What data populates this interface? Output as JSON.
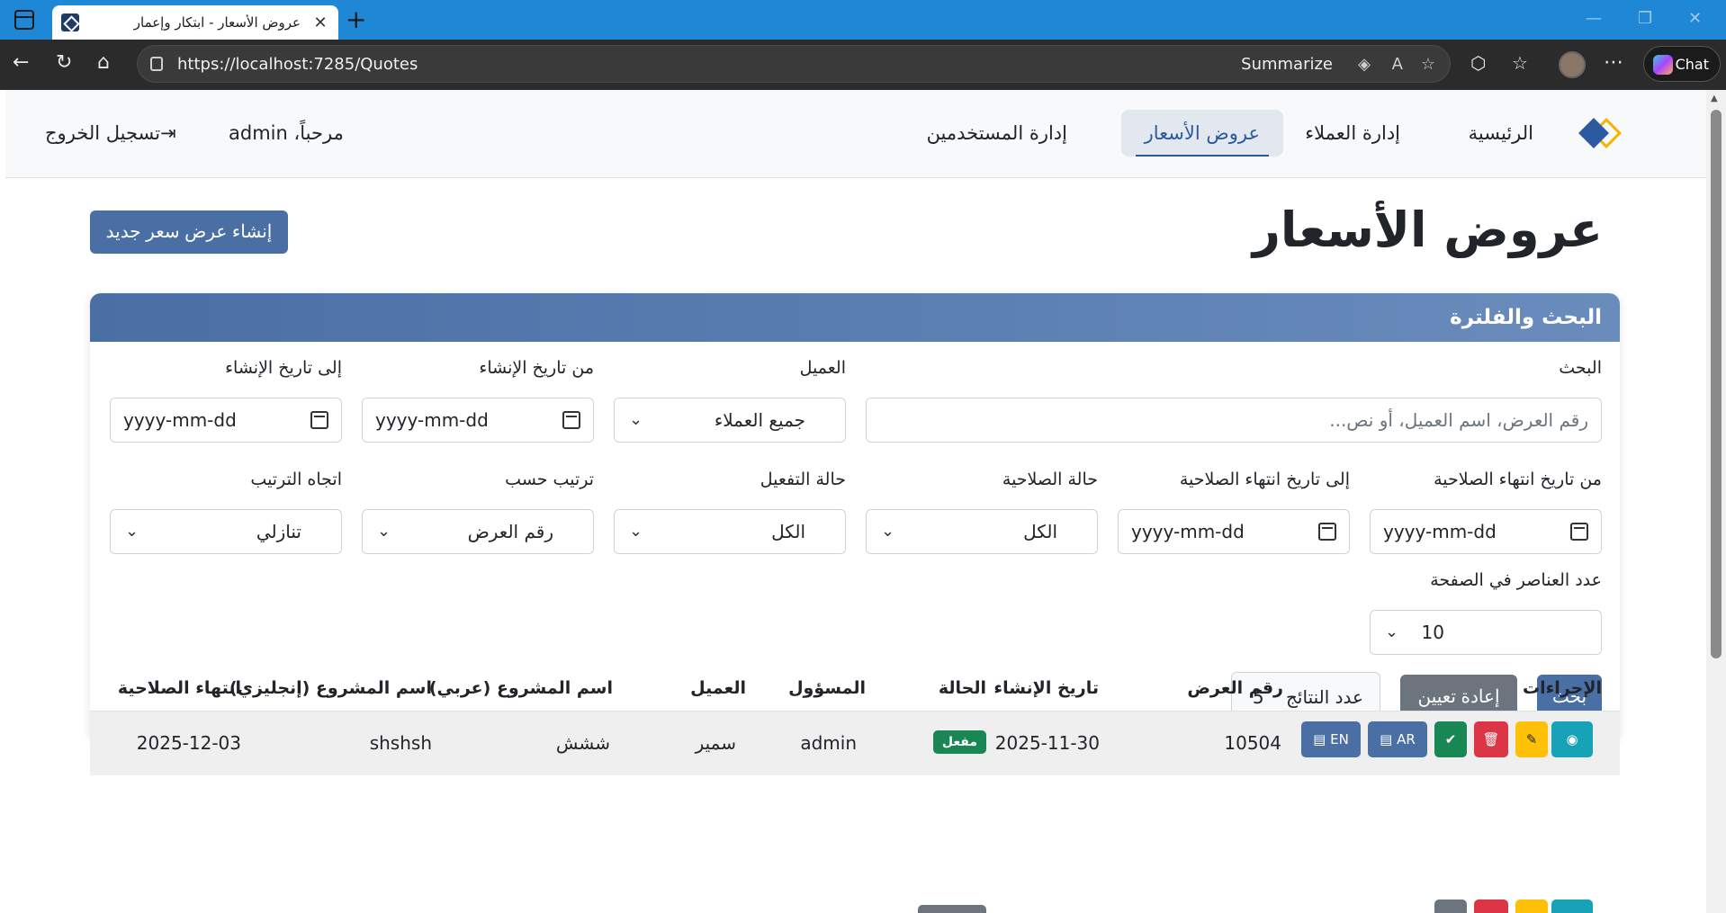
{
  "browser": {
    "tab_title": "عروض الأسعار - ابتكار وإعمار",
    "tab_close": "✕",
    "new_tab": "+",
    "url": "https://localhost:7285/Quotes",
    "summarize": "Summarize",
    "chat": "Chat"
  },
  "navbar": {
    "items": [
      {
        "label": "الرئيسية"
      },
      {
        "label": "إدارة العملاء"
      },
      {
        "label": "عروض الأسعار"
      },
      {
        "label": "إدارة المستخدمين"
      }
    ],
    "welcome": "مرحباً، admin",
    "logout": "تسجيل الخروج"
  },
  "page": {
    "title": "عروض الأسعار",
    "create_button": "إنشاء عرض سعر جديد"
  },
  "filters": {
    "header": "البحث والفلترة",
    "search_label": "البحث",
    "search_placeholder": "رقم العرض، اسم العميل، أو نص...",
    "client_label": "العميل",
    "client_value": "جميع العملاء",
    "from_created_label": "من تاريخ الإنشاء",
    "to_created_label": "إلى تاريخ الإنشاء",
    "date_placeholder": "yyyy-mm-dd",
    "from_expiry_label": "من تاريخ انتهاء الصلاحية",
    "to_expiry_label": "إلى تاريخ انتهاء الصلاحية",
    "validity_label": "حالة الصلاحية",
    "validity_value": "الكل",
    "activation_label": "حالة التفعيل",
    "activation_value": "الكل",
    "sort_by_label": "ترتيب حسب",
    "sort_by_value": "رقم العرض",
    "sort_dir_label": "اتجاه الترتيب",
    "sort_dir_value": "تنازلي",
    "page_size_label": "عدد العناصر في الصفحة",
    "page_size_value": "10",
    "search_button": "بحث",
    "reset_button": "إعادة تعيين",
    "results_label": "عدد النتائج",
    "results_count": "5"
  },
  "table": {
    "headers": [
      "الإجراءات",
      "رقم العرض",
      "تاريخ الإنشاء",
      "الحالة",
      "المسؤول",
      "العميل",
      "اسم المشروع (عربي)",
      "اسم المشروع (إنجليزي)",
      "انتهاء الصلاحية"
    ],
    "rows": [
      {
        "quote_number": "10504",
        "created": "2025-11-30",
        "status": "مفعل",
        "owner": "admin",
        "client": "سمير",
        "project_ar": "ششش",
        "project_en": "shshsh",
        "expiry": "2025-12-03"
      }
    ],
    "actions": {
      "en": "EN",
      "ar": "AR"
    }
  },
  "colors": {
    "primary": "#4a6fa5",
    "secondary": "#6c757d",
    "success": "#198754",
    "danger": "#dc3545",
    "warning": "#ffc107",
    "info": "#17a2b8"
  },
  "icons": [
    "sidebar-icon",
    "back-icon",
    "refresh-icon",
    "home-icon",
    "lock-icon",
    "star-icon",
    "extensions-icon",
    "favorites-icon",
    "more-icon",
    "logout-icon",
    "calendar-icon",
    "chevron-down-icon",
    "eye-icon",
    "edit-icon",
    "trash-icon",
    "check-icon",
    "pdf-icon"
  ]
}
